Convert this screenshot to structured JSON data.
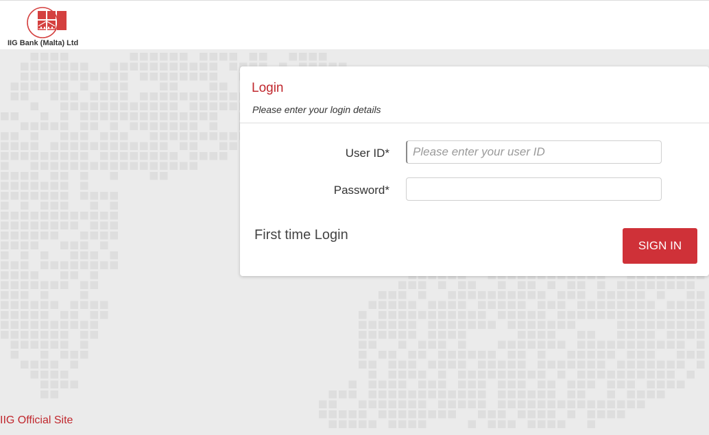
{
  "header": {
    "brand_name": "IIG Bank (Malta) Ltd"
  },
  "login": {
    "title": "Login",
    "subtitle": "Please enter your login details",
    "user_id_label": "User ID*",
    "user_id_placeholder": "Please enter your user ID",
    "user_id_value": "",
    "password_label": "Password*",
    "password_value": "",
    "first_time_label": "First time Login",
    "sign_in_label": "SIGN IN"
  },
  "footer": {
    "official_site_label": "IIG Official Site"
  },
  "colors": {
    "brand_red": "#c0272d",
    "button_red": "#cf3138",
    "background": "#ebebeb",
    "map_tile": "#dedede"
  },
  "icons": {
    "logo": "iig-logo-icon"
  }
}
